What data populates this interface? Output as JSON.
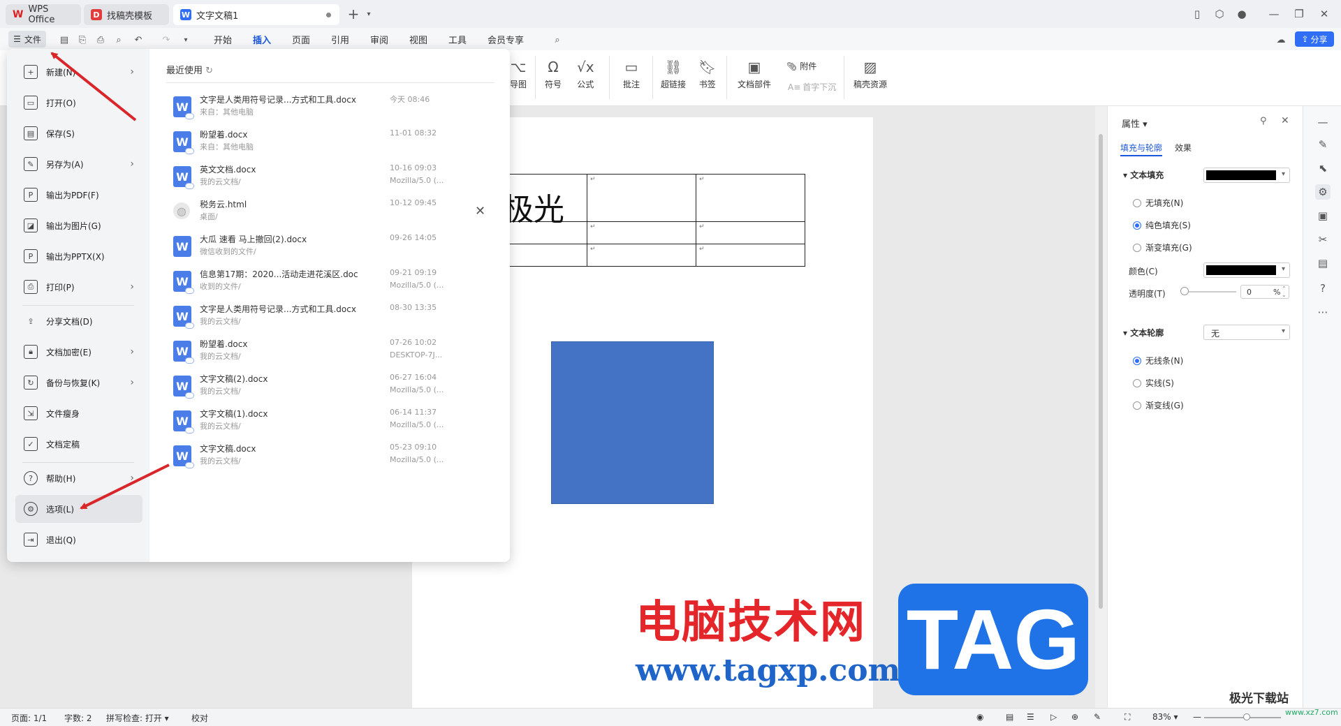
{
  "titlebar": {
    "tabs": [
      {
        "label": "WPS Office"
      },
      {
        "label": "找稿壳模板"
      },
      {
        "label": "文字文稿1"
      }
    ],
    "new_tab": "+"
  },
  "menubar": {
    "file_label": "文件",
    "tabs": [
      "开始",
      "插入",
      "页面",
      "引用",
      "审阅",
      "视图",
      "工具",
      "会员专享"
    ],
    "active_tab": "插入",
    "share_label": "分享"
  },
  "ribbon": {
    "tools": [
      {
        "label": "导图",
        "icon": "mindmap-icon"
      },
      {
        "label": "符号",
        "icon": "omega-icon"
      },
      {
        "label": "公式",
        "icon": "formula-icon"
      },
      {
        "label": "批注",
        "icon": "comment-icon"
      },
      {
        "label": "超链接",
        "icon": "link-icon"
      },
      {
        "label": "书签",
        "icon": "bookmark-icon"
      },
      {
        "label": "文档部件",
        "icon": "doc-parts-icon"
      },
      {
        "label": "附件",
        "icon": "paperclip-icon"
      },
      {
        "label": "首字下沉",
        "icon": "dropcap-icon"
      },
      {
        "label": "稿壳资源",
        "icon": "resources-icon"
      }
    ]
  },
  "file_menu": {
    "items": [
      {
        "label": "新建(N)",
        "has_sub": true
      },
      {
        "label": "打开(O)",
        "has_sub": false
      },
      {
        "label": "保存(S)",
        "has_sub": false
      },
      {
        "label": "另存为(A)",
        "has_sub": true
      },
      {
        "label": "输出为PDF(F)",
        "has_sub": false
      },
      {
        "label": "输出为图片(G)",
        "has_sub": false
      },
      {
        "label": "输出为PPTX(X)",
        "has_sub": false
      },
      {
        "label": "打印(P)",
        "has_sub": true
      },
      {
        "label": "分享文档(D)",
        "has_sub": false
      },
      {
        "label": "文档加密(E)",
        "has_sub": true
      },
      {
        "label": "备份与恢复(K)",
        "has_sub": true
      },
      {
        "label": "文件瘦身",
        "has_sub": false
      },
      {
        "label": "文档定稿",
        "has_sub": false
      },
      {
        "label": "帮助(H)",
        "has_sub": true
      },
      {
        "label": "选项(L)",
        "has_sub": false
      },
      {
        "label": "退出(Q)",
        "has_sub": false
      }
    ],
    "recent_header": "最近使用",
    "recent_files": [
      {
        "name": "文字是人类用符号记录...方式和工具.docx",
        "location": "来自：其他电脑",
        "time": "今天 08:46",
        "source": ""
      },
      {
        "name": "盼望着.docx",
        "location": "来自：其他电脑",
        "time": "11-01 08:32",
        "source": ""
      },
      {
        "name": "英文文档.docx",
        "location": "我的云文档/",
        "time": "10-16 09:03",
        "source": "Mozilla/5.0 (..."
      },
      {
        "name": "税务云.html",
        "location": "桌面/",
        "time": "10-12 09:45",
        "source": ""
      },
      {
        "name": "大瓜 速看 马上撤回(2).docx",
        "location": "微信收到的文件/",
        "time": "09-26 14:05",
        "source": ""
      },
      {
        "name": "信息第17期：2020...活动走进花溪区.doc",
        "location": "收到的文件/",
        "time": "09-21 09:19",
        "source": "Mozilla/5.0 (..."
      },
      {
        "name": "文字是人类用符号记录...方式和工具.docx",
        "location": "我的云文档/",
        "time": "08-30 13:35",
        "source": ""
      },
      {
        "name": "盼望着.docx",
        "location": "我的云文档/",
        "time": "07-26 10:02",
        "source": "DESKTOP-7J..."
      },
      {
        "name": "文字文稿(2).docx",
        "location": "我的云文档/",
        "time": "06-27 16:04",
        "source": "Mozilla/5.0 (..."
      },
      {
        "name": "文字文稿(1).docx",
        "location": "我的云文档/",
        "time": "06-14 11:37",
        "source": "Mozilla/5.0 (..."
      },
      {
        "name": "文字文稿.docx",
        "location": "我的云文档/",
        "time": "05-23 09:10",
        "source": "Mozilla/5.0 (..."
      }
    ]
  },
  "document": {
    "big_text": "极光"
  },
  "properties": {
    "title": "属性",
    "tabs": [
      "填充与轮廓",
      "效果"
    ],
    "text_fill_label": "文本填充",
    "fill_options": [
      {
        "label": "无填充(N)",
        "checked": false
      },
      {
        "label": "纯色填充(S)",
        "checked": true
      },
      {
        "label": "渐变填充(G)",
        "checked": false
      }
    ],
    "color_label": "颜色(C)",
    "transparency_label": "透明度(T)",
    "transparency_value": "0",
    "transparency_unit": "%",
    "text_outline_label": "文本轮廓",
    "outline_value": "无",
    "outline_options": [
      {
        "label": "无线条(N)",
        "checked": true
      },
      {
        "label": "实线(S)",
        "checked": false
      },
      {
        "label": "渐变线(G)",
        "checked": false
      }
    ],
    "fill_color": "#000000"
  },
  "statusbar": {
    "page": "页面: 1/1",
    "words": "字数: 2",
    "spell": "拼写检查: 打开",
    "proof": "校对",
    "zoom": "83%"
  },
  "watermark": {
    "cn": "电脑技术网",
    "url": "www.tagxp.com",
    "tag": "TAG",
    "logo": "极光下载站",
    "logo_url": "www.xz7.com"
  },
  "colors": {
    "accent": "#2f6ef5",
    "arrow": "#d9262a",
    "shape_fill": "#4472c4"
  }
}
